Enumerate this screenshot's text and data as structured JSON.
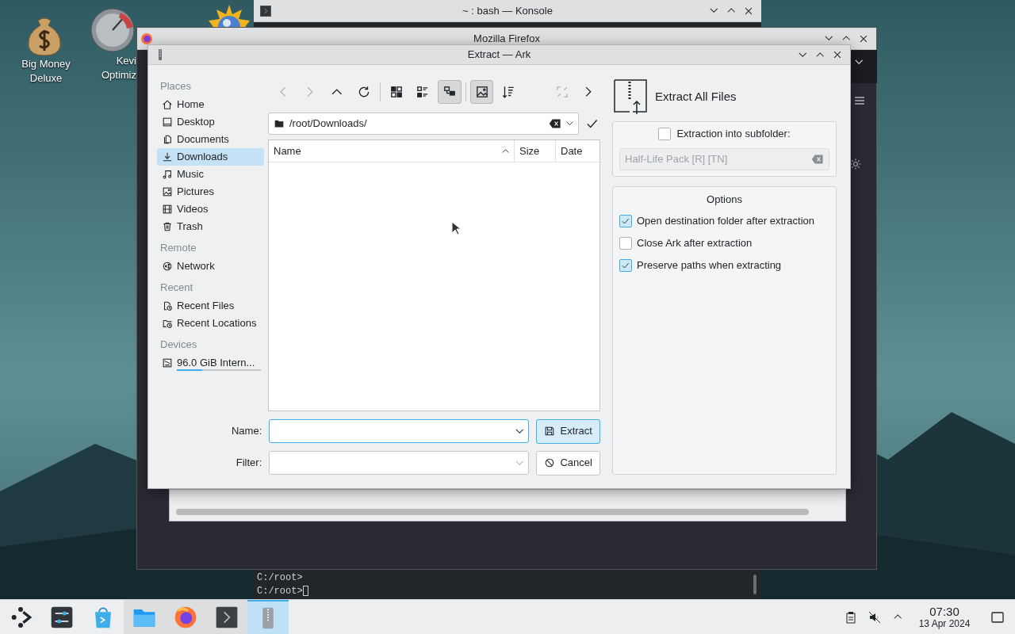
{
  "desktop_icons": [
    {
      "kind": "money",
      "lines": [
        "Big Money",
        "Deluxe"
      ]
    },
    {
      "kind": "gauge",
      "lines": [
        "Kevi",
        "Optimiz"
      ]
    },
    {
      "kind": "sun"
    }
  ],
  "konsole": {
    "title": "~ : bash — Konsole",
    "lines": [
      "C:/root>",
      "C:/root>"
    ]
  },
  "firefox": {
    "title": "Mozilla Firefox"
  },
  "ark": {
    "title": "Extract — Ark",
    "places": [
      {
        "heading": "Places",
        "items": [
          {
            "kind": "home",
            "label": "Home",
            "selected": false
          },
          {
            "kind": "desktop",
            "label": "Desktop",
            "selected": false
          },
          {
            "kind": "document",
            "label": "Documents",
            "selected": false
          },
          {
            "kind": "download",
            "label": "Downloads",
            "selected": true
          },
          {
            "kind": "music",
            "label": "Music",
            "selected": false
          },
          {
            "kind": "picture",
            "label": "Pictures",
            "selected": false
          },
          {
            "kind": "film",
            "label": "Videos",
            "selected": false
          },
          {
            "kind": "trash",
            "label": "Trash",
            "selected": false
          }
        ]
      },
      {
        "heading": "Remote",
        "items": [
          {
            "kind": "network",
            "label": "Network",
            "selected": false
          }
        ]
      },
      {
        "heading": "Recent",
        "items": [
          {
            "kind": "recent-file",
            "label": "Recent Files",
            "selected": false
          },
          {
            "kind": "recent-folder",
            "label": "Recent Locations",
            "selected": false
          }
        ]
      },
      {
        "heading": "Devices",
        "items": [
          {
            "kind": "drive",
            "label": "96.0 GiB Intern...",
            "selected": false,
            "level": 0.3
          }
        ]
      }
    ],
    "toolbar": [
      {
        "kind": "back",
        "selected": false,
        "disabled": true
      },
      {
        "kind": "forward",
        "selected": false,
        "disabled": true
      },
      {
        "kind": "up",
        "selected": false,
        "disabled": false
      },
      {
        "kind": "reload",
        "selected": false,
        "disabled": false
      },
      {
        "kind": "separator"
      },
      {
        "kind": "icons",
        "selected": false,
        "disabled": false
      },
      {
        "kind": "compact",
        "selected": false,
        "disabled": false
      },
      {
        "kind": "tree",
        "selected": true,
        "disabled": false
      },
      {
        "kind": "separator"
      },
      {
        "kind": "preview",
        "selected": true,
        "disabled": false
      },
      {
        "kind": "sort",
        "selected": false,
        "disabled": false
      },
      {
        "kind": "spacer"
      },
      {
        "kind": "zoom",
        "selected": false,
        "disabled": true
      },
      {
        "kind": "more",
        "selected": false,
        "disabled": false
      }
    ],
    "path": "/root/Downloads/",
    "columns": [
      {
        "label": "Name",
        "sorted": true
      },
      {
        "label": "Size",
        "sorted": false
      },
      {
        "label": "Date",
        "sorted": false
      }
    ],
    "name_label": "Name:",
    "filter_label": "Filter:",
    "buttons": [
      {
        "kind": "extract",
        "label": "Extract",
        "default": true
      },
      {
        "kind": "cancel",
        "label": "Cancel",
        "default": false
      }
    ],
    "heading": "Extract All Files",
    "subfolder": {
      "label": "Extraction into subfolder:",
      "checked": false,
      "value": "Half-Life Pack [R] [TN]",
      "disabled": true
    },
    "options_title": "Options",
    "options": [
      {
        "label": "Open destination folder after extraction",
        "checked": true
      },
      {
        "label": "Close Ark after extraction",
        "checked": false
      },
      {
        "label": "Preserve paths when extracting",
        "checked": true
      }
    ]
  },
  "taskbar": [
    {
      "kind": "launcher",
      "open": false,
      "selected": false
    },
    {
      "kind": "settings",
      "open": false,
      "selected": false
    },
    {
      "kind": "store",
      "open": false,
      "selected": false
    },
    {
      "kind": "files",
      "open": true,
      "selected": false
    },
    {
      "kind": "firefox",
      "open": true,
      "selected": false
    },
    {
      "kind": "terminal",
      "open": true,
      "selected": false
    },
    {
      "kind": "archive",
      "open": true,
      "selected": true
    }
  ],
  "tray": {
    "muted": true,
    "time": "07:30",
    "date": "13 Apr 2024"
  }
}
